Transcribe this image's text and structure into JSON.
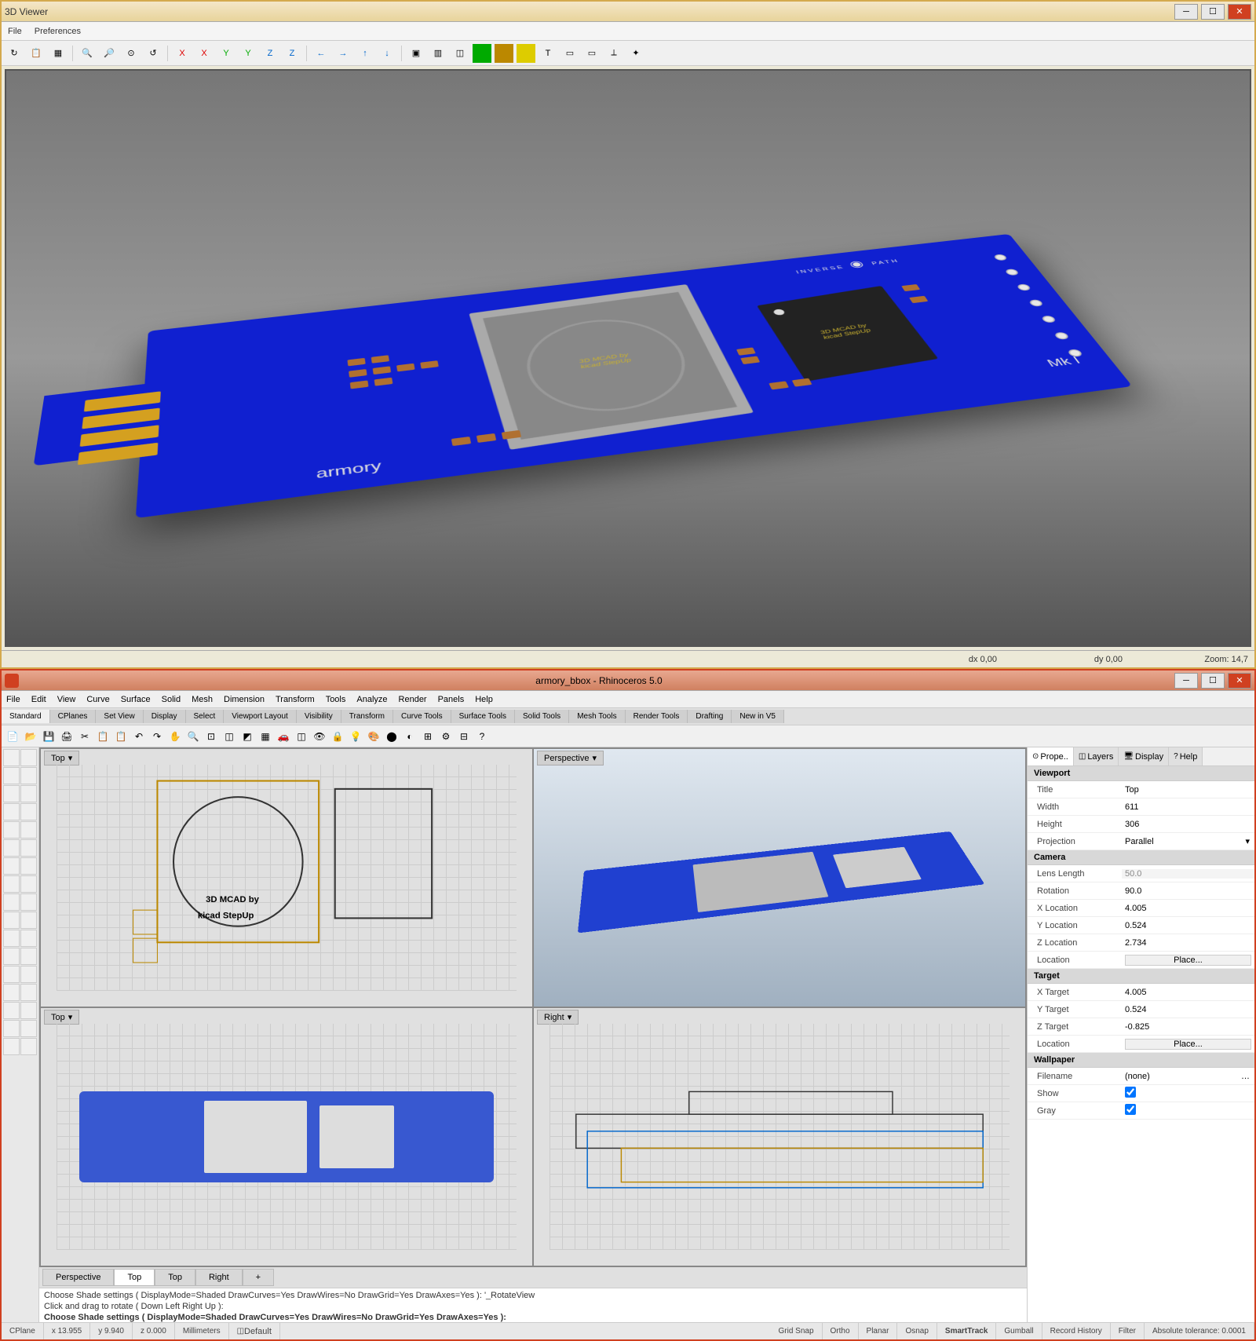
{
  "viewer": {
    "title": "3D Viewer",
    "menu": [
      "File",
      "Preferences"
    ],
    "status": {
      "dx": "dx 0,00",
      "dy": "dy 0,00",
      "zoom": "Zoom: 14,7"
    },
    "pcb": {
      "brand1": "INVERSE",
      "brand2": "PATH",
      "name": "armory",
      "rev": "Mk I",
      "chip_text1": "3D MCAD by",
      "chip_text2": "kicad StepUp"
    }
  },
  "rhino": {
    "title": "armory_bbox - Rhinoceros 5.0",
    "menu": [
      "File",
      "Edit",
      "View",
      "Curve",
      "Surface",
      "Solid",
      "Mesh",
      "Dimension",
      "Transform",
      "Tools",
      "Analyze",
      "Render",
      "Panels",
      "Help"
    ],
    "tabs": [
      "Standard",
      "CPlanes",
      "Set View",
      "Display",
      "Select",
      "Viewport Layout",
      "Visibility",
      "Transform",
      "Curve Tools",
      "Surface Tools",
      "Solid Tools",
      "Mesh Tools",
      "Render Tools",
      "Drafting",
      "New in V5"
    ],
    "vp": {
      "persp": "Perspective",
      "top": "Top",
      "right": "Right"
    },
    "vptabs": [
      "Perspective",
      "Top",
      "Top",
      "Right"
    ],
    "cmd": {
      "l1": "Choose Shade settings ( DisplayMode=Shaded  DrawCurves=Yes  DrawWires=No  DrawGrid=Yes  DrawAxes=Yes ): '_RotateView",
      "l2": "Click and drag to rotate ( Down  Left  Right  Up ):",
      "l3": "Choose Shade settings ( DisplayMode=Shaded  DrawCurves=Yes  DrawWires=No  DrawGrid=Yes  DrawAxes=Yes ): "
    },
    "status": {
      "cplane": "CPlane",
      "x": "x 13.955",
      "y": "y 9.940",
      "z": "z 0.000",
      "units": "Millimeters",
      "layer": "Default",
      "items": [
        "Grid Snap",
        "Ortho",
        "Planar",
        "Osnap",
        "SmartTrack",
        "Gumball",
        "Record History",
        "Filter"
      ],
      "tol": "Absolute tolerance: 0.0001"
    },
    "props": {
      "tabs": [
        "Prope..",
        "Layers",
        "Display",
        "Help"
      ],
      "viewport": {
        "title_h": "Viewport",
        "Title": "Top",
        "Width": "611",
        "Height": "306",
        "Projection": "Parallel"
      },
      "camera": {
        "title_h": "Camera",
        "LensLength": "50.0",
        "Rotation": "90.0",
        "XLocation": "4.005",
        "YLocation": "0.524",
        "ZLocation": "2.734",
        "Location": "Place..."
      },
      "target": {
        "title_h": "Target",
        "XTarget": "4.005",
        "YTarget": "0.524",
        "ZTarget": "-0.825",
        "Location": "Place..."
      },
      "wallpaper": {
        "title_h": "Wallpaper",
        "Filename": "(none)",
        "Show": true,
        "Gray": true
      }
    }
  }
}
